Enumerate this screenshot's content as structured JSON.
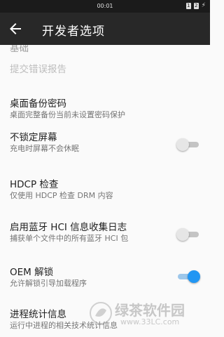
{
  "status_bar": {
    "time": "00:01",
    "sim1": "1",
    "sim2": "2"
  },
  "app_bar": {
    "title": "开发者选项"
  },
  "list": {
    "partial_top": "基础",
    "bug_report": "提交错误报告",
    "desktop_backup": {
      "title": "桌面备份密码",
      "summary": "桌面完整备份当前未设置密码保护"
    },
    "stay_awake": {
      "title": "不锁定屏幕",
      "summary": "充电时屏幕不会休眠",
      "enabled": false
    },
    "hdcp": {
      "title": "HDCP 检查",
      "summary": "仅使用 HDCP 检查 DRM 内容"
    },
    "bt_hci": {
      "title": "启用蓝牙 HCI 信息收集日志",
      "summary": "捕获单个文件中的所有蓝牙 HCI 包",
      "enabled": false
    },
    "oem_unlock": {
      "title": "OEM 解锁",
      "summary": "允许解锁引导加载程序",
      "enabled": true
    },
    "process_stats": {
      "title": "进程统计信息",
      "summary": "运行中进程的相关技术统计信息"
    }
  },
  "watermark": {
    "name": "绿茶软件园",
    "url": "www.33LC.com"
  },
  "colors": {
    "accent": "#2196f3",
    "app_bar": "#282828",
    "status_bar": "#1b1b1b"
  }
}
